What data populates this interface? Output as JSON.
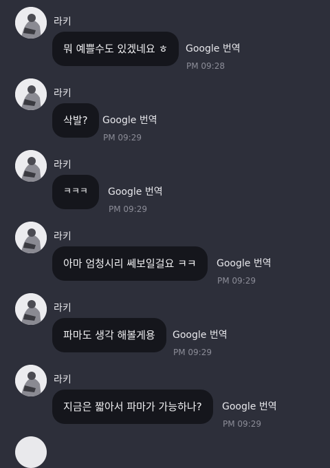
{
  "messages": [
    {
      "sender": "라키",
      "text": "뭐 예쁠수도 있겠네요 ㅎ",
      "translate_label": "Google 번역",
      "time": "PM 09:28"
    },
    {
      "sender": "라키",
      "text": "삭발?",
      "translate_label": "Google 번역",
      "time": "PM 09:29"
    },
    {
      "sender": "라키",
      "text": "ㅋㅋㅋ",
      "translate_label": "Google 번역",
      "time": "PM 09:29"
    },
    {
      "sender": "라키",
      "text": "아마 엄청시리 쎄보일걸요 ㅋㅋ",
      "translate_label": "Google 번역",
      "time": "PM 09:29"
    },
    {
      "sender": "라키",
      "text": "파마도 생각 해볼게용",
      "translate_label": "Google 번역",
      "time": "PM 09:29"
    },
    {
      "sender": "라키",
      "text": "지금은 짧아서 파마가 가능하나?",
      "translate_label": "Google 번역",
      "time": "PM 09:29"
    }
  ]
}
